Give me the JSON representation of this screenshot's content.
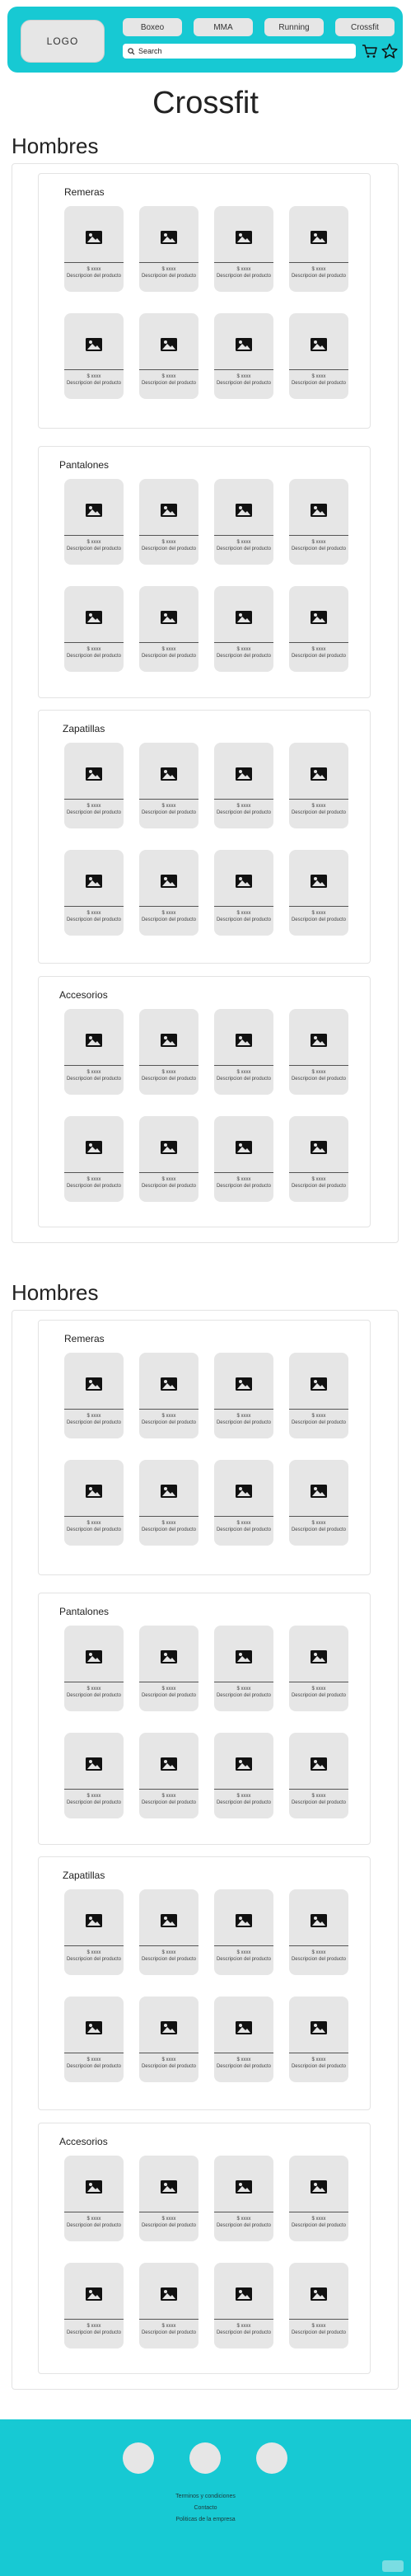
{
  "header": {
    "logo": "LOGO",
    "nav": [
      "Boxeo",
      "MMA",
      "Running",
      "Crossfit"
    ],
    "search_placeholder": "Search"
  },
  "page_title": "Crossfit",
  "sections": [
    {
      "title": "Hombres",
      "categories": [
        "Remeras",
        "Pantalones",
        "Zapatillas",
        "Accesorios"
      ]
    },
    {
      "title": "Hombres",
      "categories": [
        "Remeras",
        "Pantalones",
        "Zapatillas",
        "Accesorios"
      ]
    }
  ],
  "product": {
    "price": "$ xxxx",
    "description": "Descripcion del producto"
  },
  "footer": {
    "links": [
      "Terminos y condiciones",
      "Contacto",
      "Politicas de la empresa"
    ]
  },
  "colors": {
    "accent": "#17c9d3",
    "card": "#e6e6e6"
  }
}
